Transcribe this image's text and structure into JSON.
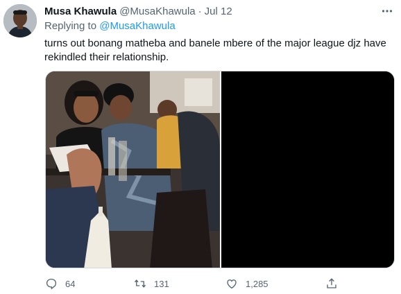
{
  "tweet": {
    "display_name": "Musa Khawula",
    "handle": "@MusaKhawula",
    "separator": "·",
    "date": "Jul 12",
    "reply_prefix": "Replying to",
    "reply_to": "@MusaKhawula",
    "text": "turns out bonang matheba and banele mbere of the major league djz have rekindled their relationship."
  },
  "actions": {
    "replies": "64",
    "retweets": "131",
    "likes": "1,285"
  },
  "icons": {
    "more": "more-icon",
    "reply": "reply-icon",
    "retweet": "retweet-icon",
    "like": "heart-icon",
    "share": "share-icon"
  },
  "colors": {
    "text": "#0f1419",
    "secondary": "#536471",
    "link": "#1d9bf0"
  }
}
